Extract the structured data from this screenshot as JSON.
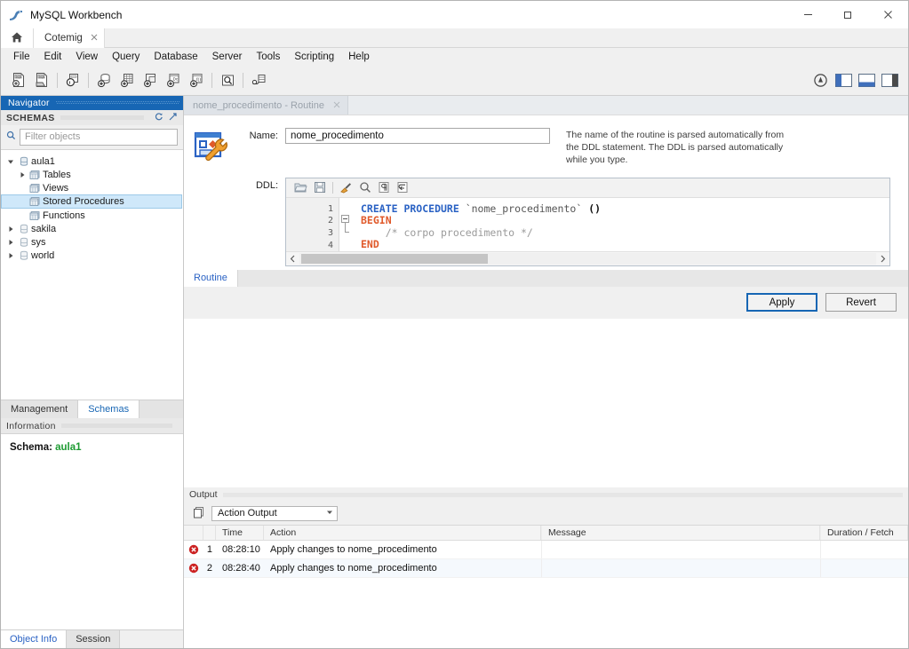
{
  "window": {
    "title": "MySQL Workbench",
    "logo_icon": "mysql-dolphin-icon",
    "minimize_label": "—",
    "maximize_label": "❐",
    "close_label": "✕"
  },
  "tabstrip": {
    "home_icon": "home-icon",
    "connection_tab": {
      "label": "Cotemig",
      "close_icon": "close-icon"
    }
  },
  "menubar": {
    "items": [
      "File",
      "Edit",
      "View",
      "Query",
      "Database",
      "Server",
      "Tools",
      "Scripting",
      "Help"
    ]
  },
  "toolbar": {
    "items": [
      {
        "name": "new-sql-tab-icon",
        "title": "New SQL tab"
      },
      {
        "name": "open-sql-script-icon",
        "title": "Open SQL script"
      },
      {
        "name": "connect-to-database-icon",
        "title": "Connect to database"
      },
      {
        "name": "new-schema-icon",
        "title": "Create new schema"
      },
      {
        "name": "new-table-icon",
        "title": "Create new table"
      },
      {
        "name": "new-view-icon",
        "title": "Create new view"
      },
      {
        "name": "new-procedure-icon",
        "title": "Create new stored procedure"
      },
      {
        "name": "new-function-icon",
        "title": "Create new function"
      },
      {
        "name": "search-data-icon",
        "title": "Search table data"
      },
      {
        "name": "reconnect-dbms-icon",
        "title": "Reconnect to DBMS"
      }
    ],
    "right_items": [
      {
        "name": "toggle-help-icon",
        "title": "Help"
      },
      {
        "name": "toggle-sidebar-icon",
        "title": "Toggle sidebar"
      },
      {
        "name": "toggle-output-icon",
        "title": "Toggle output area"
      },
      {
        "name": "toggle-secondary-sidebar-icon",
        "title": "Toggle secondary sidebar"
      }
    ]
  },
  "navigator": {
    "title": "Navigator",
    "schemas_header": {
      "label": "SCHEMAS",
      "refresh_icon": "refresh-icon",
      "collapse_icon": "collapse-all-icon"
    },
    "filter": {
      "icon": "search-icon",
      "placeholder": "Filter objects",
      "value": ""
    },
    "tree": [
      {
        "label": "aula1",
        "icon": "schema-icon",
        "level": 0,
        "expanded": true,
        "selected": false
      },
      {
        "label": "Tables",
        "icon": "folder-objects-icon",
        "level": 1,
        "expanded": false,
        "selected": false
      },
      {
        "label": "Views",
        "icon": "folder-objects-icon",
        "level": 1,
        "expanded": null,
        "selected": false
      },
      {
        "label": "Stored Procedures",
        "icon": "folder-objects-icon",
        "level": 1,
        "expanded": null,
        "selected": true
      },
      {
        "label": "Functions",
        "icon": "folder-objects-icon",
        "level": 1,
        "expanded": null,
        "selected": false
      },
      {
        "label": "sakila",
        "icon": "schema-icon",
        "level": 0,
        "expanded": false,
        "selected": false
      },
      {
        "label": "sys",
        "icon": "schema-icon",
        "level": 0,
        "expanded": false,
        "selected": false
      },
      {
        "label": "world",
        "icon": "schema-icon",
        "level": 0,
        "expanded": false,
        "selected": false
      }
    ],
    "tabs": [
      {
        "label": "Management",
        "active": false
      },
      {
        "label": "Schemas",
        "active": true
      }
    ],
    "information": {
      "header": "Information",
      "schema_label": "Schema:",
      "schema_value": "aula1",
      "value_color": "#1d9b32"
    },
    "bottom_tabs": [
      {
        "label": "Object Info",
        "active": true
      },
      {
        "label": "Session",
        "active": false
      }
    ]
  },
  "editor": {
    "tab": {
      "label": "nome_procedimento - Routine",
      "close_icon": "close-icon"
    },
    "big_icon": "routine-editor-icon",
    "name_field": {
      "label": "Name:",
      "value": "nome_procedimento",
      "placeholder": ""
    },
    "help_text": "The name of the routine is parsed automatically from the DDL statement. The DDL is parsed automatically while you type.",
    "ddl_label": "DDL:",
    "ddl_toolbar": [
      {
        "name": "open-file-icon",
        "title": "Open file"
      },
      {
        "name": "save-file-icon",
        "title": "Save file"
      },
      {
        "name": "beautify-query-icon",
        "title": "Beautify/reformat SQL"
      },
      {
        "name": "find-icon",
        "title": "Find"
      },
      {
        "name": "toggle-invisible-chars-icon",
        "title": "Toggle invisible characters"
      },
      {
        "name": "toggle-word-wrap-icon",
        "title": "Toggle word wrap"
      }
    ],
    "code": {
      "lines": [
        {
          "number": "1",
          "breakpoint": true,
          "tokens": [
            {
              "text": "    ",
              "cls": ""
            },
            {
              "text": "CREATE PROCEDURE ",
              "cls": "k"
            },
            {
              "text": "`nome_procedimento`",
              "cls": "q"
            },
            {
              "text": " ()",
              "cls": "p"
            }
          ]
        },
        {
          "number": "2",
          "breakpoint": false,
          "tokens": [
            {
              "text": "BEGIN",
              "cls": "be"
            }
          ]
        },
        {
          "number": "3",
          "breakpoint": false,
          "tokens": [
            {
              "text": "    /* corpo procedimento */",
              "cls": "cm"
            }
          ]
        },
        {
          "number": "4",
          "breakpoint": false,
          "tokens": [
            {
              "text": "END",
              "cls": "be"
            }
          ]
        }
      ]
    },
    "hscroll": {
      "left_icon": "chevron-left-icon",
      "right_icon": "chevron-right-icon"
    },
    "routine_tabs": [
      {
        "label": "Routine",
        "active": true
      }
    ],
    "buttons": {
      "apply": "Apply",
      "revert": "Revert",
      "focused": "Apply"
    }
  },
  "output": {
    "header": "Output",
    "selector": {
      "icon": "output-pages-icon",
      "value": "Action Output",
      "caret_icon": "chevron-down-icon"
    },
    "columns": [
      "",
      "",
      "Time",
      "Action",
      "Message",
      "Duration / Fetch"
    ],
    "rows": [
      {
        "status_icon": "error-icon",
        "number": "1",
        "time": "08:28:10",
        "action": "Apply changes to nome_procedimento",
        "message": "",
        "duration": ""
      },
      {
        "status_icon": "error-icon",
        "number": "2",
        "time": "08:28:40",
        "action": "Apply changes to nome_procedimento",
        "message": "",
        "duration": ""
      }
    ]
  },
  "colors": {
    "accent_blue": "#1766b4",
    "selection_blue": "#cfe8fa",
    "error_red": "#cc2222",
    "schema_green": "#1d9b32",
    "keyword_blue": "#2a62c4",
    "beginend_orange": "#e05a2b"
  }
}
